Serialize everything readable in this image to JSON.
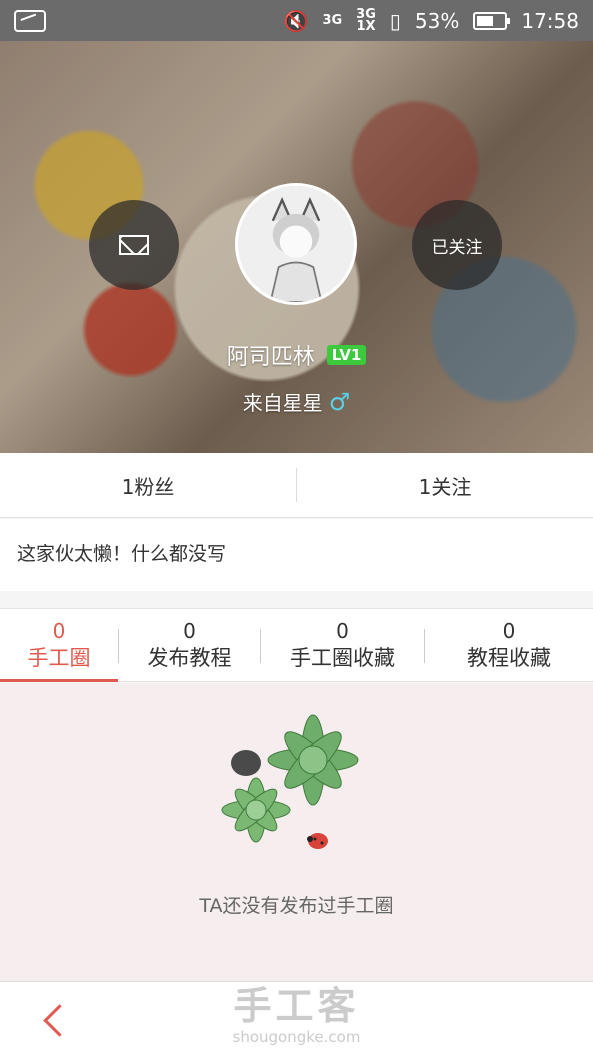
{
  "status_bar": {
    "network": "3G",
    "signal_labels": [
      "3G",
      "1X"
    ],
    "battery_percent": "53%",
    "time": "17:58"
  },
  "profile": {
    "username": "阿司匹林",
    "level": "LV1",
    "location": "来自星星",
    "gender_symbol": "♂",
    "follow_button": "已关注",
    "message_button_icon": "mail-icon"
  },
  "stats": {
    "fans": "1粉丝",
    "following": "1关注"
  },
  "bio": "这家伙太懒！什么都没写",
  "tabs": [
    {
      "count": "0",
      "label": "手工圈",
      "active": true
    },
    {
      "count": "0",
      "label": "发布教程",
      "active": false
    },
    {
      "count": "0",
      "label": "手工圈收藏",
      "active": false
    },
    {
      "count": "0",
      "label": "教程收藏",
      "active": false
    }
  ],
  "empty_state": {
    "text": "TA还没有发布过手工圈"
  },
  "bottom_bar": {
    "back_icon": "chevron-left-icon",
    "watermark_main": "手工客",
    "watermark_sub": "shougongke.com"
  },
  "colors": {
    "accent": "#e05a4f",
    "level_badge": "#3cc93c",
    "gender": "#5ad0e6"
  }
}
